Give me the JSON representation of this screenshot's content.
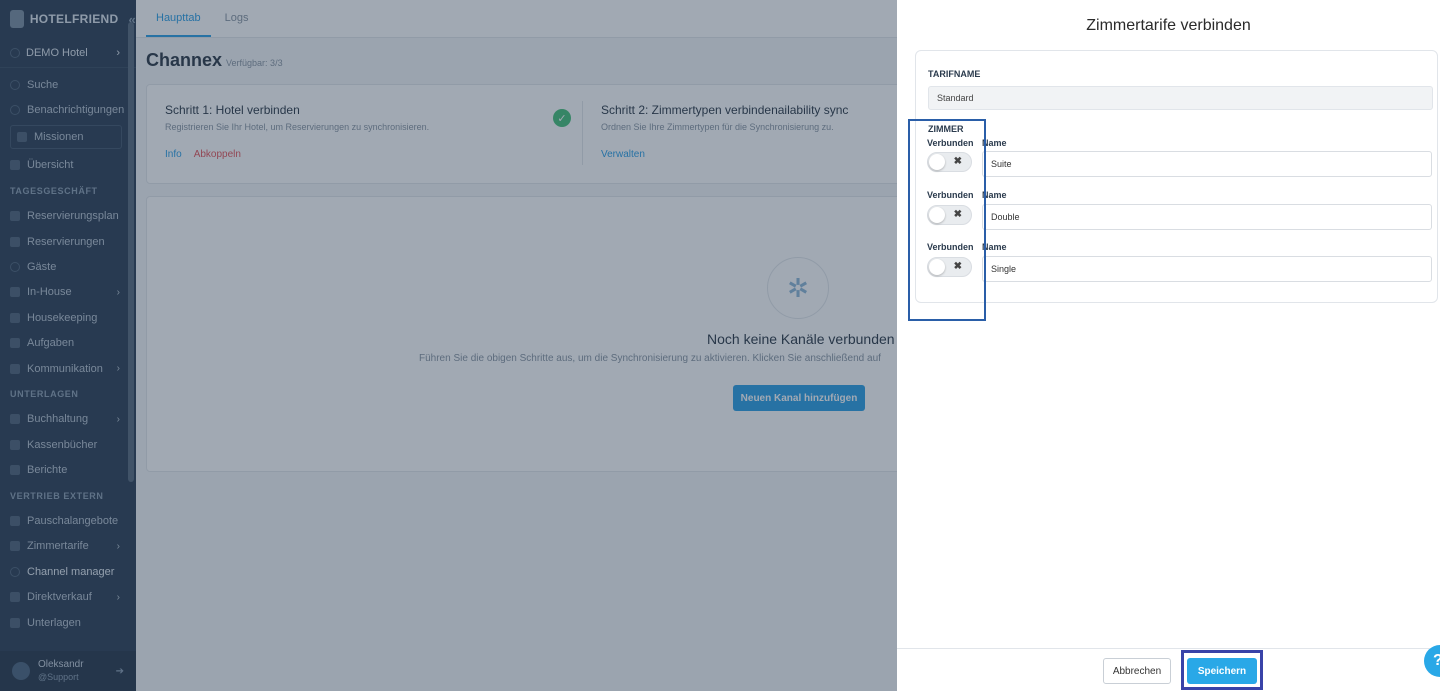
{
  "sidebar": {
    "logo_text": "HOTELFRIEND",
    "collapse_icon": "«",
    "hotel_name": "DEMO Hotel",
    "hotel_arrow": "›",
    "search": "Suche",
    "notifications": "Benachrichtigungen",
    "missions": "Missionen",
    "overview": "Übersicht",
    "section_daily": "TAGESGESCHÄFT",
    "reservation_plan": "Reservierungsplan",
    "reservations": "Reservierungen",
    "guests": "Gäste",
    "in_house": "In-House",
    "housekeeping": "Housekeeping",
    "tasks": "Aufgaben",
    "communication": "Kommunikation",
    "section_docs": "UNTERLAGEN",
    "accounting": "Buchhaltung",
    "cashbooks": "Kassenbücher",
    "reports": "Berichte",
    "section_sales": "VERTRIEB EXTERN",
    "packages": "Pauschalangebote",
    "room_rates": "Zimmertarife",
    "channel_manager": "Channel manager",
    "direct_sales": "Direktverkauf",
    "documents": "Unterlagen",
    "chevron": "›",
    "user_name": "Oleksandr",
    "user_role": "@Support",
    "logout_icon": "➔"
  },
  "main": {
    "tab_main": "Haupttab",
    "tab_logs": "Logs",
    "title": "Channex",
    "available": "Verfügbar: 3/3",
    "step1_title": "Schritt 1: Hotel verbinden",
    "step1_desc": "Registrieren Sie Ihr Hotel, um Reservierungen zu synchronisieren.",
    "step1_info": "Info",
    "step1_disconnect": "Abkoppeln",
    "check_icon": "✓",
    "step2_title": "Schritt 2: Zimmertypen verbindenailability sync",
    "step2_desc": "Ordnen Sie Ihre Zimmertypen für die Synchronisierung zu.",
    "step2_manage": "Verwalten",
    "empty_icon": "✲",
    "empty_title": "Noch keine Kanäle verbunden",
    "empty_desc": "Führen Sie die obigen Schritte aus, um die Synchronisierung zu aktivieren. Klicken Sie anschließend auf",
    "add_channel": "Neuen Kanal hinzufügen"
  },
  "modal": {
    "title": "Zimmertarife verbinden",
    "tarif_label": "TARIFNAME",
    "tarif_value": "Standard",
    "rooms_label": "ZIMMER",
    "connected_label": "Verbunden",
    "name_label": "Name",
    "toggle_x": "✖",
    "rooms": [
      {
        "name": "Suite",
        "connected": false
      },
      {
        "name": "Double",
        "connected": false
      },
      {
        "name": "Single",
        "connected": false
      }
    ],
    "cancel": "Abbrechen",
    "save": "Speichern"
  },
  "help_label": "?",
  "colors": {
    "accent": "#29a8e7",
    "sidebar_bg": "#2f4156",
    "highlight_blue": "#2a5ea8",
    "highlight_save": "#3943a8"
  }
}
